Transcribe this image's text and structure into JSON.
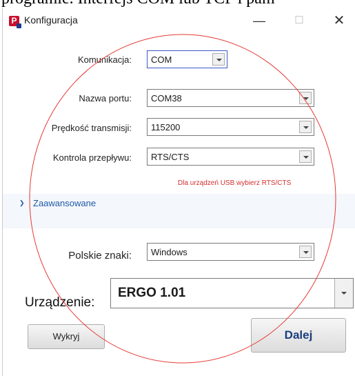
{
  "background_text": "programie. Interfejs COM lub TCP i pam",
  "window": {
    "title": "Konfiguracja",
    "controls": {
      "minimize": "—",
      "maximize": "☐",
      "close": "✕"
    }
  },
  "form": {
    "komunikacja": {
      "label": "Komunikacja:",
      "value": "COM"
    },
    "nazwa_portu": {
      "label": "Nazwa portu:",
      "value": "COM38"
    },
    "predkosc": {
      "label": "Prędkość transmisji:",
      "value": "115200"
    },
    "kontrola": {
      "label": "Kontrola przepływu:",
      "value": "RTS/CTS"
    },
    "hint": "Dla urządzeń USB wybierz RTS/CTS"
  },
  "advanced": {
    "label": "Zaawansowane",
    "polskie_znaki": {
      "label": "Polskie znaki:",
      "value": "Windows"
    }
  },
  "device": {
    "label": "Urządzenie:",
    "value": "ERGO 1.01"
  },
  "buttons": {
    "detect": "Wykryj",
    "next": "Dalej"
  },
  "colors": {
    "accent": "#1e5aa8",
    "hint": "#d32f2f",
    "annotation": "#e53935"
  }
}
